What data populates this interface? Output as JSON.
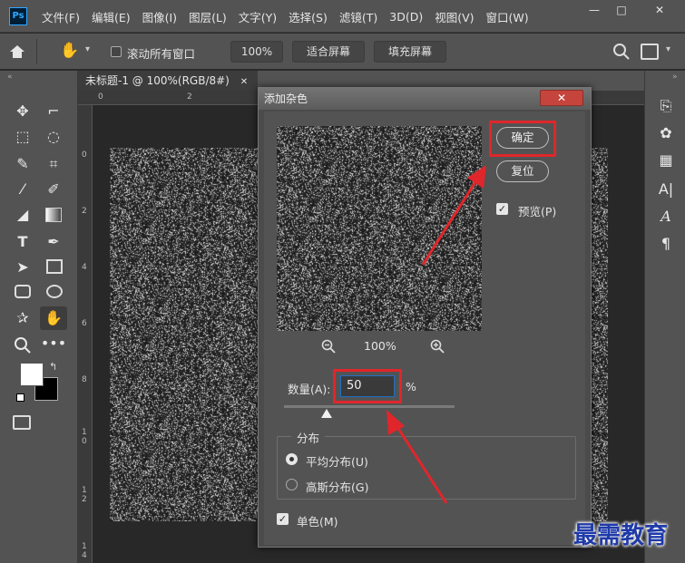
{
  "app": {
    "logo": "Ps"
  },
  "menu": [
    "文件(F)",
    "编辑(E)",
    "图像(I)",
    "图层(L)",
    "文字(Y)",
    "选择(S)",
    "滤镜(T)",
    "3D(D)",
    "视图(V)",
    "窗口(W)"
  ],
  "window_controls": {
    "minimize": "—",
    "maximize": "□",
    "close": "✕"
  },
  "options_bar": {
    "scroll_all_label": "滚动所有窗口",
    "zoom_value": "100%",
    "fit_screen_label": "适合屏幕",
    "fill_screen_label": "填充屏幕"
  },
  "document": {
    "tab_title": "未标题-1 @ 100%(RGB/8#)",
    "tab_close": "✕",
    "ruler_top_marks": [
      "0",
      "2"
    ],
    "ruler_left_marks": [
      "0",
      "2",
      "4",
      "6",
      "8",
      "1\n0",
      "1\n2",
      "1\n4"
    ]
  },
  "dialog": {
    "title": "添加杂色",
    "ok_label": "确定",
    "reset_label": "复位",
    "preview_label": "预览(P)",
    "preview_checked": true,
    "zoom_value": "100%",
    "amount_label": "数量(A):",
    "amount_value": "50",
    "amount_unit": "%",
    "amount_fraction": 0.25,
    "distribution_title": "分布",
    "uniform_label": "平均分布(U)",
    "gaussian_label": "高斯分布(G)",
    "uniform_selected": true,
    "mono_label": "单色(M)",
    "mono_checked": true
  },
  "colors": {
    "annotation_red": "#e0262b",
    "foreground": "#ffffff",
    "background": "#000000"
  },
  "watermark": "最需教育"
}
